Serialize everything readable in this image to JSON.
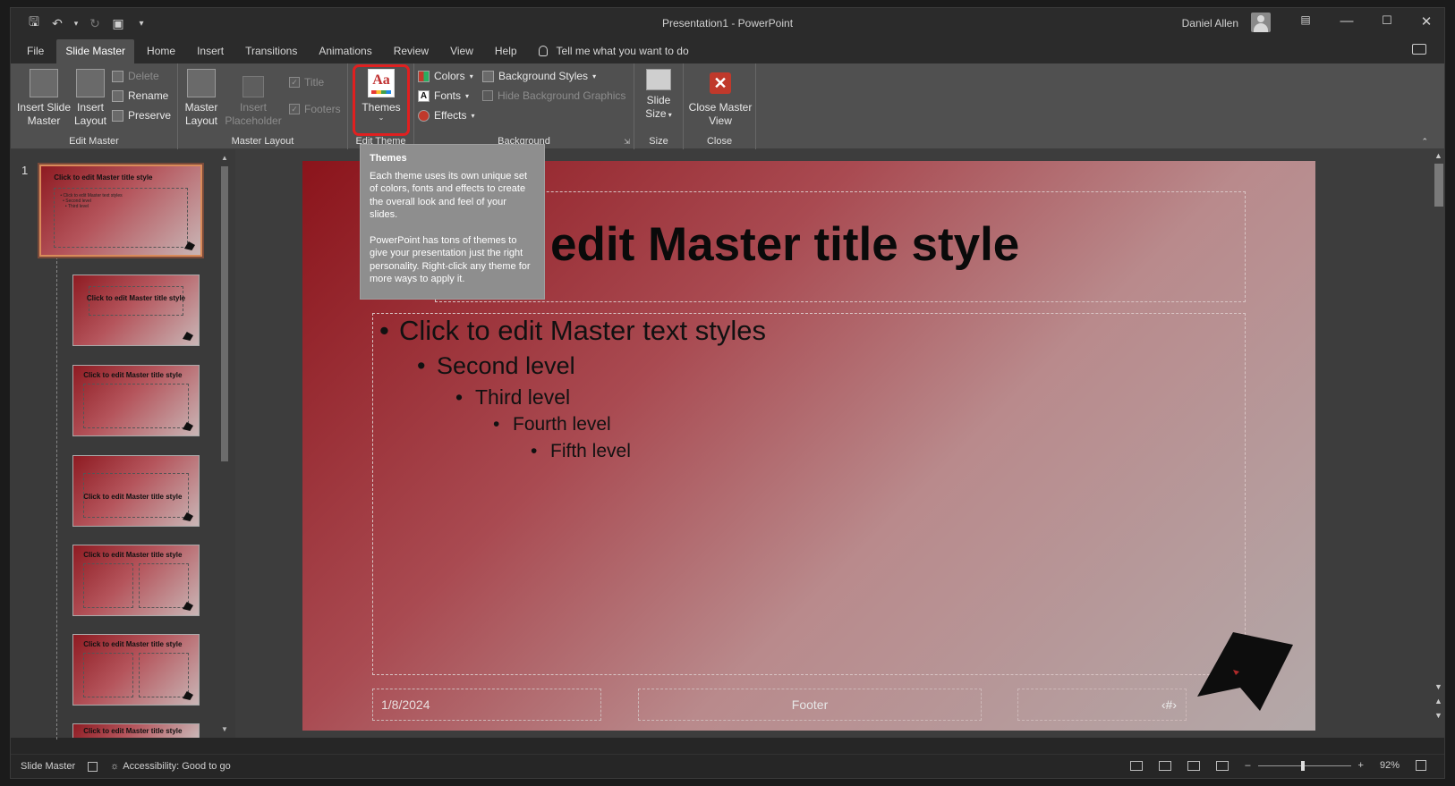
{
  "titlebar": {
    "title": "Presentation1  -  PowerPoint",
    "user": "Daniel Allen",
    "qat_icons": [
      "save-icon",
      "undo-icon",
      "redo-icon",
      "present-icon",
      "customize-icon"
    ]
  },
  "tabs": [
    "File",
    "Slide Master",
    "Home",
    "Insert",
    "Transitions",
    "Animations",
    "Review",
    "View",
    "Help"
  ],
  "active_tab": "Slide Master",
  "tell_me": "Tell me what you want to do",
  "ribbon": {
    "edit_master": {
      "label": "Edit Master",
      "insert_slide_master": "Insert Slide Master",
      "insert_layout": "Insert Layout",
      "delete": "Delete",
      "rename": "Rename",
      "preserve": "Preserve"
    },
    "master_layout": {
      "label": "Master Layout",
      "master_layout_btn": "Master Layout",
      "insert_placeholder": "Insert Placeholder",
      "title": "Title",
      "footers": "Footers"
    },
    "edit_theme": {
      "label": "Edit Theme",
      "themes": "Themes"
    },
    "background": {
      "label": "Background",
      "colors": "Colors",
      "fonts": "Fonts",
      "effects": "Effects",
      "background_styles": "Background Styles",
      "hide_background_graphics": "Hide Background Graphics"
    },
    "size": {
      "label": "Size",
      "slide_size": "Slide Size"
    },
    "close": {
      "label": "Close",
      "close_master_view": "Close Master View"
    }
  },
  "tooltip": {
    "title": "Themes",
    "p1": "Each theme uses its own unique set of colors, fonts and effects to create the overall look and feel of your slides.",
    "p2": "PowerPoint has tons of themes to give your presentation just the right personality. Right-click any theme for more ways to apply it."
  },
  "thumbnails": {
    "slide_number": "1",
    "items": [
      {
        "title": "Click to edit Master title style"
      },
      {
        "title": "Click to edit Master title style"
      },
      {
        "title": "Click to edit Master title style"
      },
      {
        "title": "Click to edit Master title style"
      },
      {
        "title": "Click to edit Master title style"
      },
      {
        "title": "Click to edit Master title style"
      },
      {
        "title": "Click to edit Master title style"
      }
    ]
  },
  "slide": {
    "title": "edit Master title style",
    "levels": [
      "Click to edit Master text styles",
      "Second level",
      "Third level",
      "Fourth level",
      "Fifth level"
    ],
    "footer_date": "1/8/2024",
    "footer": "Footer",
    "slide_number": "‹#›"
  },
  "status": {
    "view": "Slide Master",
    "accessibility": "Accessibility: Good to go",
    "zoom": "92%"
  }
}
